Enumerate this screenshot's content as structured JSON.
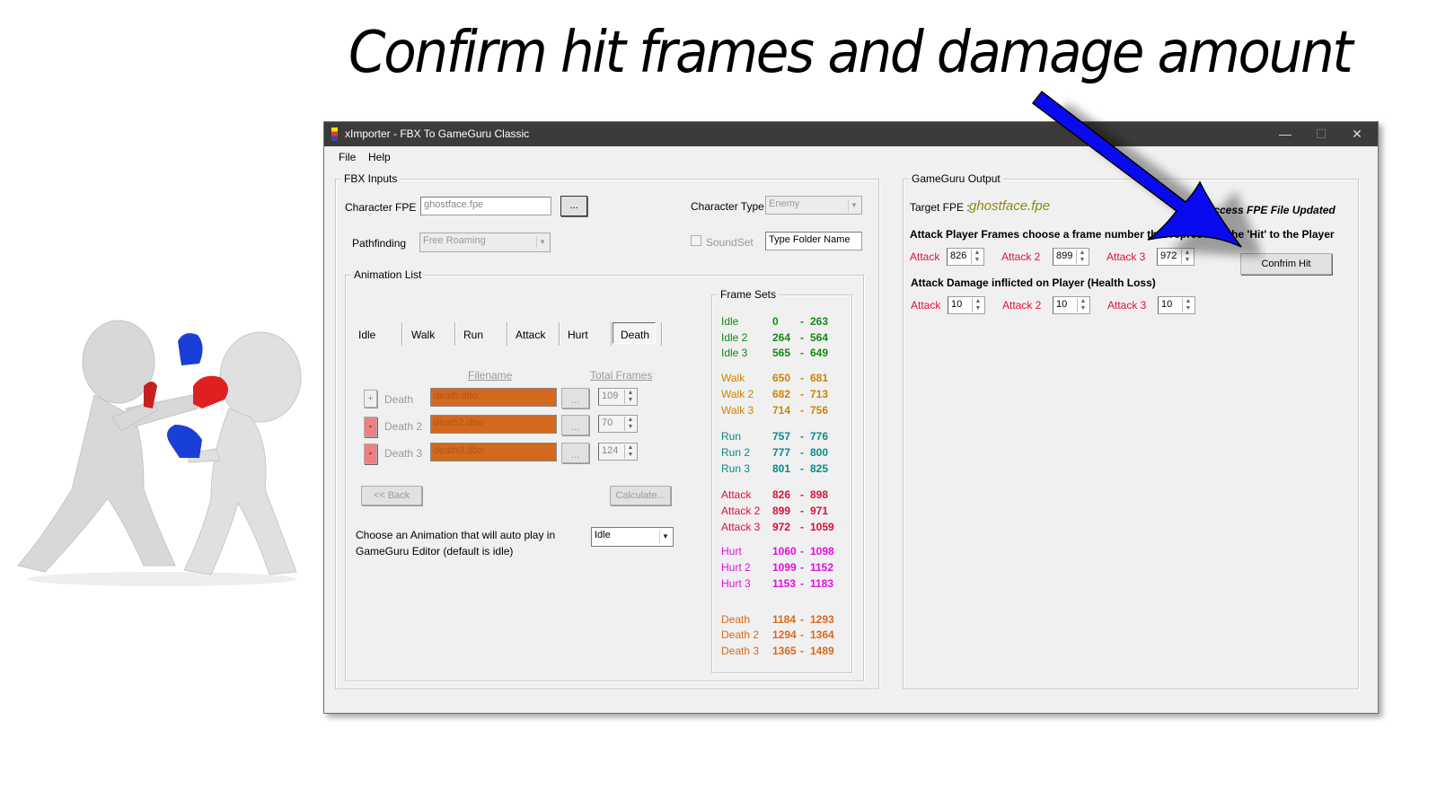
{
  "headline": "Confirm hit frames and damage amount",
  "window": {
    "title": "xImporter - FBX To GameGuru Classic",
    "controls": {
      "minimize": "—",
      "maximize": "☐",
      "close": "✕"
    }
  },
  "menu": [
    "File",
    "Help"
  ],
  "fbx_inputs": {
    "legend": "FBX Inputs",
    "character_fpe_label": "Character FPE",
    "character_fpe_value": "ghostface.fpe",
    "browse_label": "...",
    "pathfinding_label": "Pathfinding",
    "pathfinding_value": "Free Roaming",
    "character_type_label": "Character Type",
    "character_type_value": "Enemy",
    "soundset_label": "SoundSet",
    "soundset_checked": false,
    "folder_placeholder": "Type Folder Name"
  },
  "animation_list": {
    "legend": "Animation List",
    "tabs": [
      "Idle",
      "Walk",
      "Run",
      "Attack",
      "Hurt",
      "Death"
    ],
    "active_tab": "Death",
    "col_filename": "Filename",
    "col_total_frames": "Total Frames",
    "rows": [
      {
        "toggle": "+",
        "name": "Death",
        "file": "death.dbo",
        "browse": "...",
        "frames": "109"
      },
      {
        "toggle": "-",
        "name": "Death 2",
        "file": "death2.dbo",
        "browse": "...",
        "frames": "70"
      },
      {
        "toggle": "-",
        "name": "Death 3",
        "file": "death3.dbo",
        "browse": "...",
        "frames": "124"
      }
    ],
    "back_label": "<< Back",
    "calculate_label": "Calculate...",
    "autoplay_text_1": "Choose an Animation that will auto play in",
    "autoplay_text_2": "GameGuru Editor (default is idle)",
    "autoplay_value": "Idle"
  },
  "frame_sets": {
    "legend": "Frame Sets",
    "groups": [
      {
        "color": "#138a13",
        "items": [
          [
            "Idle",
            "0",
            "263"
          ],
          [
            "Idle 2",
            "264",
            "564"
          ],
          [
            "Idle 3",
            "565",
            "649"
          ]
        ]
      },
      {
        "color": "#c8860a",
        "items": [
          [
            "Walk",
            "650",
            "681"
          ],
          [
            "Walk 2",
            "682",
            "713"
          ],
          [
            "Walk 3",
            "714",
            "756"
          ]
        ]
      },
      {
        "color": "#0a8a8a",
        "items": [
          [
            "Run",
            "757",
            "776"
          ],
          [
            "Run 2",
            "777",
            "800"
          ],
          [
            "Run 3",
            "801",
            "825"
          ]
        ]
      },
      {
        "color": "#d8103c",
        "items": [
          [
            "Attack",
            "826",
            "898"
          ],
          [
            "Attack 2",
            "899",
            "971"
          ],
          [
            "Attack 3",
            "972",
            "1059"
          ]
        ]
      },
      {
        "color": "#e010e0",
        "items": [
          [
            "Hurt",
            "1060",
            "1098"
          ],
          [
            "Hurt 2",
            "1099",
            "1152"
          ],
          [
            "Hurt 3",
            "1153",
            "1183"
          ]
        ]
      },
      {
        "color": "#d9691a",
        "items": [
          [
            "Death",
            "1184",
            "1293"
          ],
          [
            "Death 2",
            "1294",
            "1364"
          ],
          [
            "Death 3",
            "1365",
            "1489"
          ]
        ]
      }
    ]
  },
  "output": {
    "legend": "GameGuru Output",
    "target_label": "Target FPE :",
    "target_value": "ghostface.fpe",
    "status": "Success FPE File Updated",
    "hit_heading": "Attack Player Frames choose a frame number that represents the 'Hit' to the Player",
    "hit_fields": [
      {
        "label": "Attack",
        "value": "826"
      },
      {
        "label": "Attack 2",
        "value": "899"
      },
      {
        "label": "Attack 3",
        "value": "972"
      }
    ],
    "confirm_label": "Confrim Hit",
    "damage_heading": "Attack Damage inflicted on Player (Health Loss)",
    "damage_fields": [
      {
        "label": "Attack",
        "value": "10"
      },
      {
        "label": "Attack 2",
        "value": "10"
      },
      {
        "label": "Attack 3",
        "value": "10"
      }
    ]
  },
  "colors": {
    "accent_arrow": "#0000ee",
    "attack_label": "#e0103c",
    "target_fpe": "#8a8a10",
    "filename_fill": "#d2691e"
  }
}
